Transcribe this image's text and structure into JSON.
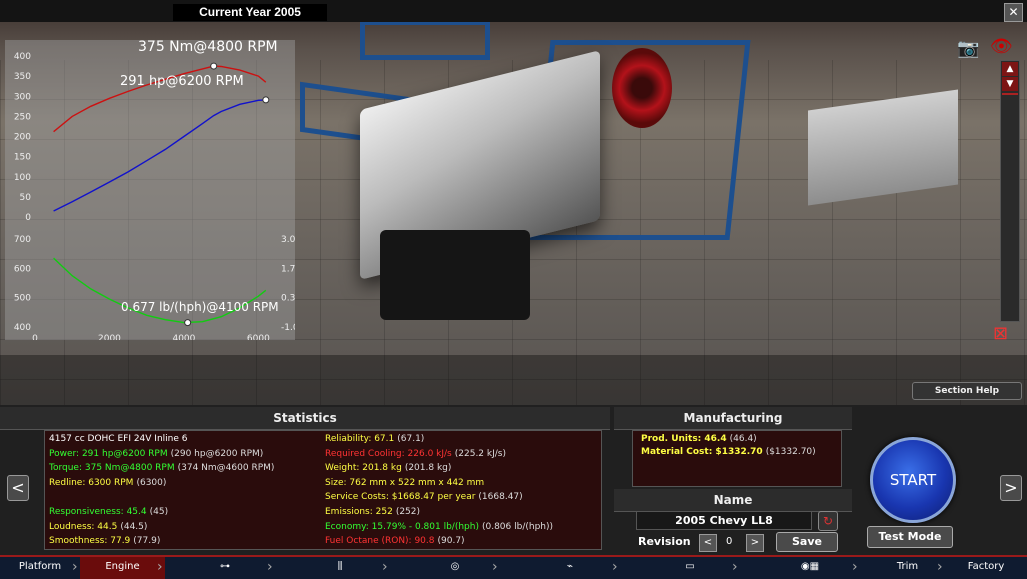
{
  "header": {
    "year_label": "Current Year 2005",
    "close": "✕"
  },
  "viewport": {
    "camera_icon": "📷",
    "eye_icon": "👁",
    "scroll_up": "▲",
    "scroll_down": "▼",
    "expand_icon": "⊠",
    "section_help": "Section Help"
  },
  "chart_data": [
    {
      "type": "line",
      "x": [
        500,
        1000,
        1500,
        2000,
        2500,
        3000,
        3500,
        4000,
        4500,
        4800,
        5000,
        5500,
        6000,
        6200
      ],
      "series": [
        {
          "name": "Torque",
          "color": "#cc1111",
          "values": [
            212,
            250,
            275,
            295,
            312,
            328,
            342,
            356,
            368,
            375,
            374,
            365,
            350,
            335
          ]
        },
        {
          "name": "Power",
          "color": "#1111cc",
          "values": [
            15,
            38,
            62,
            87,
            112,
            140,
            168,
            200,
            232,
            252,
            262,
            280,
            290,
            291
          ]
        }
      ],
      "xlim": [
        0,
        6500
      ],
      "ylim": [
        0,
        400
      ],
      "yticks": [
        0,
        50,
        100,
        150,
        200,
        250,
        300,
        350,
        400
      ],
      "annotations": [
        "375 Nm@4800 RPM",
        "291 hp@6200 RPM"
      ],
      "grid": false
    },
    {
      "type": "line",
      "x": [
        500,
        1000,
        1500,
        2000,
        2500,
        3000,
        3500,
        4000,
        4500,
        5000,
        5500,
        6000,
        6200
      ],
      "series": [
        {
          "name": "Economy",
          "color": "#11cc11",
          "values": [
            635,
            575,
            530,
            495,
            465,
            440,
            425,
            415,
            418,
            435,
            465,
            505,
            525
          ]
        }
      ],
      "xlim": [
        0,
        6500
      ],
      "ylim": [
        400,
        700
      ],
      "yticks": [
        400,
        500,
        600,
        700
      ],
      "y2ticks": [
        "3.0",
        "1.7",
        "0.3",
        "-1.0"
      ],
      "xticks": [
        0,
        2000,
        4000,
        6000
      ],
      "annotations": [
        "0.677 lb/(hph)@4100 RPM"
      ],
      "grid": false
    }
  ],
  "statistics": {
    "title": "Statistics",
    "left": [
      {
        "label": "4157 cc DOHC EFI 24V Inline 6",
        "prev": "",
        "color": "w"
      },
      {
        "label": "Power: 291 hp@6200 RPM",
        "prev": "(290 hp@6200 RPM)",
        "color": "g"
      },
      {
        "label": "Torque: 375 Nm@4800 RPM",
        "prev": "(374 Nm@4600 RPM)",
        "color": "g"
      },
      {
        "label": "Redline: 6300 RPM",
        "prev": "(6300)",
        "color": "y"
      },
      {
        "label": "",
        "prev": "",
        "color": "w"
      },
      {
        "label": "Responsiveness: 45.4",
        "prev": "(45)",
        "color": "g"
      },
      {
        "label": "Loudness: 44.5",
        "prev": "(44.5)",
        "color": "y"
      },
      {
        "label": "Smoothness: 77.9",
        "prev": "(77.9)",
        "color": "y"
      }
    ],
    "right": [
      {
        "label": "Reliability: 67.1",
        "prev": "(67.1)",
        "color": "y"
      },
      {
        "label": "Required Cooling: 226.0 kJ/s",
        "prev": "(225.2 kJ/s)",
        "color": "r"
      },
      {
        "label": "Weight: 201.8 kg",
        "prev": "(201.8 kg)",
        "color": "y"
      },
      {
        "label": "Size: 762 mm x 522 mm x 442 mm",
        "prev": "",
        "color": "y"
      },
      {
        "label": "Service Costs: $1668.47 per year",
        "prev": "(1668.47)",
        "color": "y"
      },
      {
        "label": "Emissions: 252",
        "prev": "(252)",
        "color": "y"
      },
      {
        "label": "Economy: 15.79% - 0.801 lb/(hph)",
        "prev": "(0.806 lb/(hph))",
        "color": "g"
      },
      {
        "label": "Fuel Octane (RON): 90.8",
        "prev": "(90.7)",
        "color": "r"
      }
    ],
    "prev_button": "<",
    "next_button": ">"
  },
  "manufacturing": {
    "title": "Manufacturing",
    "rows": [
      {
        "label": "Prod. Units: 46.4",
        "prev": "(46.4)"
      },
      {
        "label": "Material Cost: $1332.70",
        "prev": "($1332.70)"
      }
    ]
  },
  "name_panel": {
    "title": "Name",
    "value": "2005 Chevy LL8",
    "refresh": "↻",
    "revision_label": "Revision",
    "revision_value": "0",
    "rev_prev": "<",
    "rev_next": ">",
    "save": "Save"
  },
  "controls": {
    "start": "START",
    "test_mode": "Test Mode"
  },
  "nav": [
    {
      "label": "Platform",
      "active": false
    },
    {
      "label": "Engine",
      "active": true
    },
    {
      "label": "⊶",
      "active": false
    },
    {
      "label": "⫼",
      "active": false
    },
    {
      "label": "◎",
      "active": false
    },
    {
      "label": "⌁",
      "active": false
    },
    {
      "label": "▭",
      "active": false
    },
    {
      "label": "◉▦",
      "active": false
    },
    {
      "label": "Trim",
      "active": false
    },
    {
      "label": "Factory",
      "active": false
    }
  ],
  "colors": {
    "accent": "#9a1a1a",
    "nav_bg": "#0f1b30",
    "start_blue": "#1936b0"
  }
}
